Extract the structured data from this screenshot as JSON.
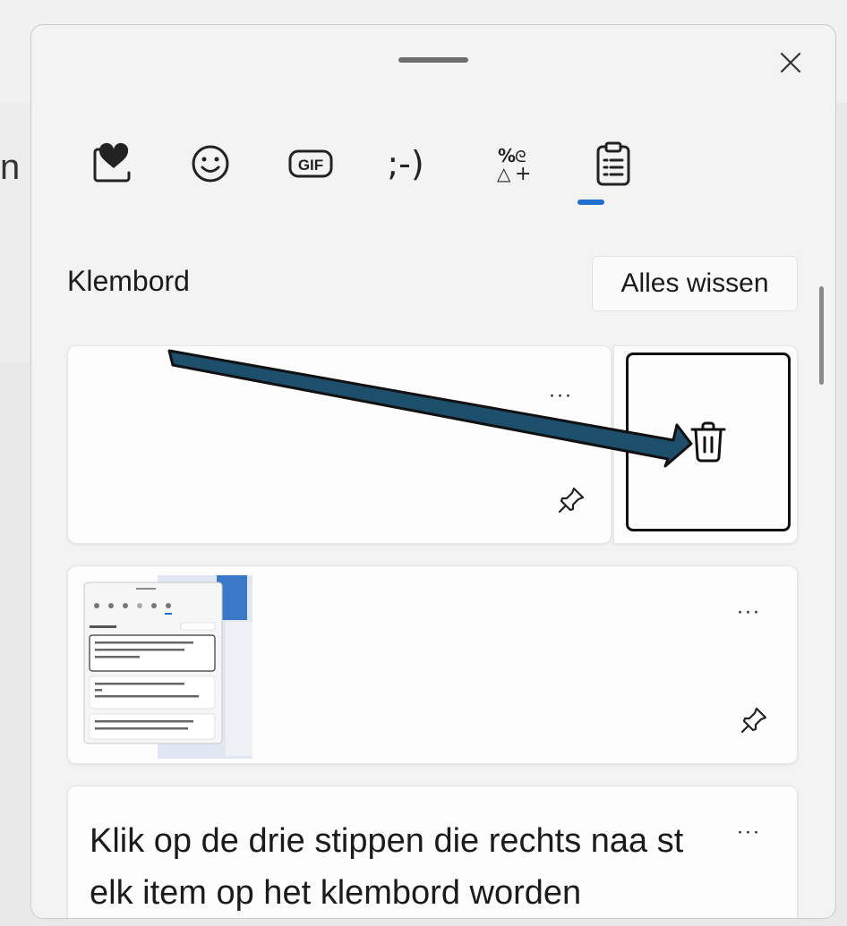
{
  "background": {
    "partial_char": "n"
  },
  "panel": {
    "close_icon": "close-icon",
    "tabs": [
      {
        "id": "favorites",
        "icon": "heart-icon"
      },
      {
        "id": "emoji",
        "icon": "smiley-icon"
      },
      {
        "id": "gif",
        "icon": "gif-icon",
        "label": "GIF"
      },
      {
        "id": "kaomoji",
        "icon": "kaomoji-icon",
        "label": ";-)"
      },
      {
        "id": "symbols",
        "icon": "symbols-icon"
      },
      {
        "id": "clipboard",
        "icon": "clipboard-icon",
        "selected": true
      }
    ],
    "accent_color": "#1f6fcf"
  },
  "clipboard": {
    "title": "Klembord",
    "clear_all": "Alles wissen",
    "items": [
      {
        "type": "empty",
        "more": "···",
        "highlight_action": "delete"
      },
      {
        "type": "image",
        "more": "···"
      },
      {
        "type": "text",
        "more": "···",
        "text": "Klik op de drie stippen die rechts naa st elk item op het klembord worden"
      }
    ]
  },
  "annotation": {
    "arrow_color": "#1d4e6b"
  }
}
